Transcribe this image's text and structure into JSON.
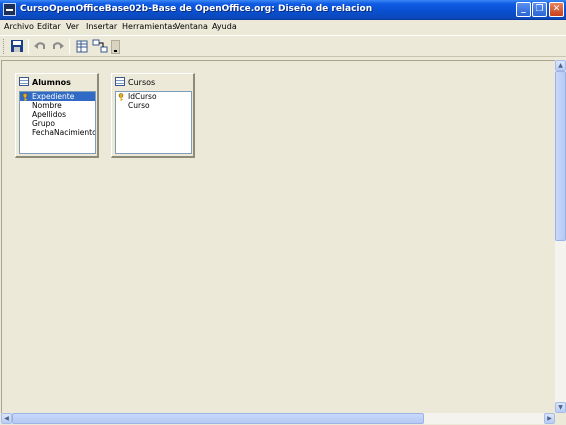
{
  "window": {
    "title": "CursoOpenOfficeBase02b-Base de OpenOffice.org: Diseño de relacion",
    "controls": {
      "minimize": "_",
      "maximize": "❐",
      "close": "✕"
    }
  },
  "menu": {
    "items": [
      "Archivo",
      "Editar",
      "Ver",
      "Insertar",
      "Herramientas",
      "Ventana",
      "Ayuda"
    ]
  },
  "toolbar": {
    "buttons": [
      "save-icon",
      "undo-icon",
      "redo-icon",
      "add-table-icon",
      "new-relation-icon",
      "more-options-icon"
    ]
  },
  "tables": [
    {
      "name": "Alumnos",
      "fields": [
        "Expediente",
        "Nombre",
        "Apellidos",
        "Grupo",
        "FechaNacimiento"
      ],
      "primary_key": "Expediente",
      "selected_field": "Expediente"
    },
    {
      "name": "Cursos",
      "fields": [
        "IdCurso",
        "Curso"
      ],
      "primary_key": "IdCurso"
    }
  ],
  "colors": {
    "titlebar": "#0A4FD0",
    "selection": "#316AC5",
    "workspace": "#ECE9D8"
  }
}
